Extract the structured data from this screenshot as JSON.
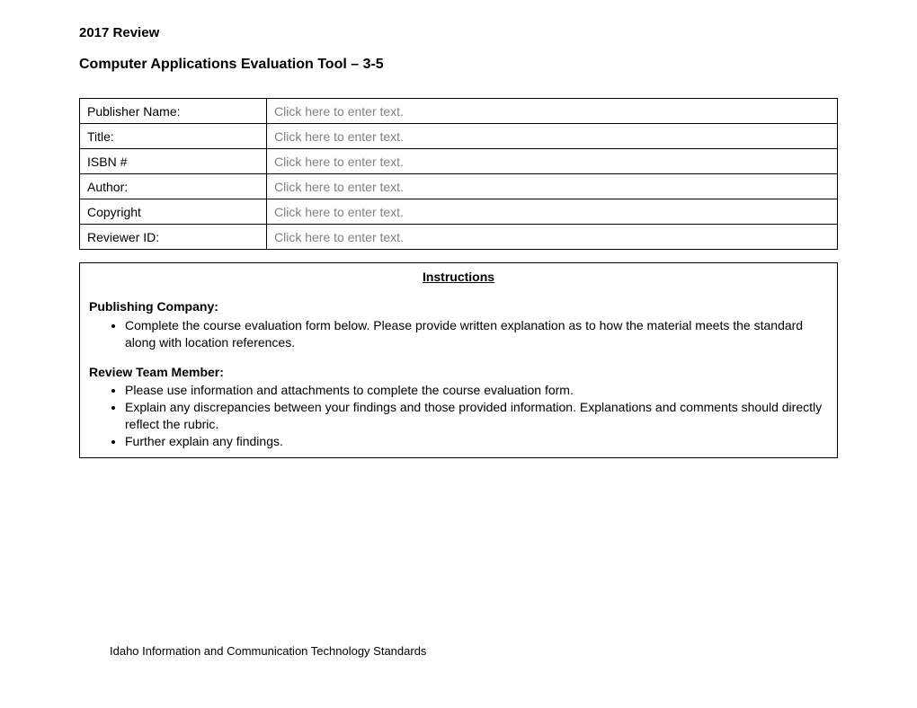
{
  "header": {
    "review_year": "2017 Review",
    "title": "Computer Applications Evaluation Tool – 3-5"
  },
  "info_fields": [
    {
      "label": "Publisher Name:",
      "placeholder": "Click here to enter text."
    },
    {
      "label": "Title:",
      "placeholder": "Click here to enter text."
    },
    {
      "label": "ISBN #",
      "placeholder": "Click here to enter text."
    },
    {
      "label": "Author:",
      "placeholder": "Click here to enter text."
    },
    {
      "label": "Copyright",
      "placeholder": "Click here to enter text."
    },
    {
      "label": "Reviewer ID:",
      "placeholder": "Click here to enter text."
    }
  ],
  "instructions": {
    "heading": "Instructions",
    "publishing_company": {
      "heading": "Publishing Company",
      "items": [
        "Complete the course evaluation form below. Please provide written explanation as to how the material meets the standard along with location references."
      ]
    },
    "review_team": {
      "heading": "Review Team Member",
      "items": [
        "Please use information and attachments to complete the course evaluation form.",
        "Explain any discrepancies between your findings and those provided information.  Explanations and comments should directly reflect the rubric.",
        "Further explain any findings."
      ]
    }
  },
  "footer": "Idaho Information and Communication Technology Standards"
}
